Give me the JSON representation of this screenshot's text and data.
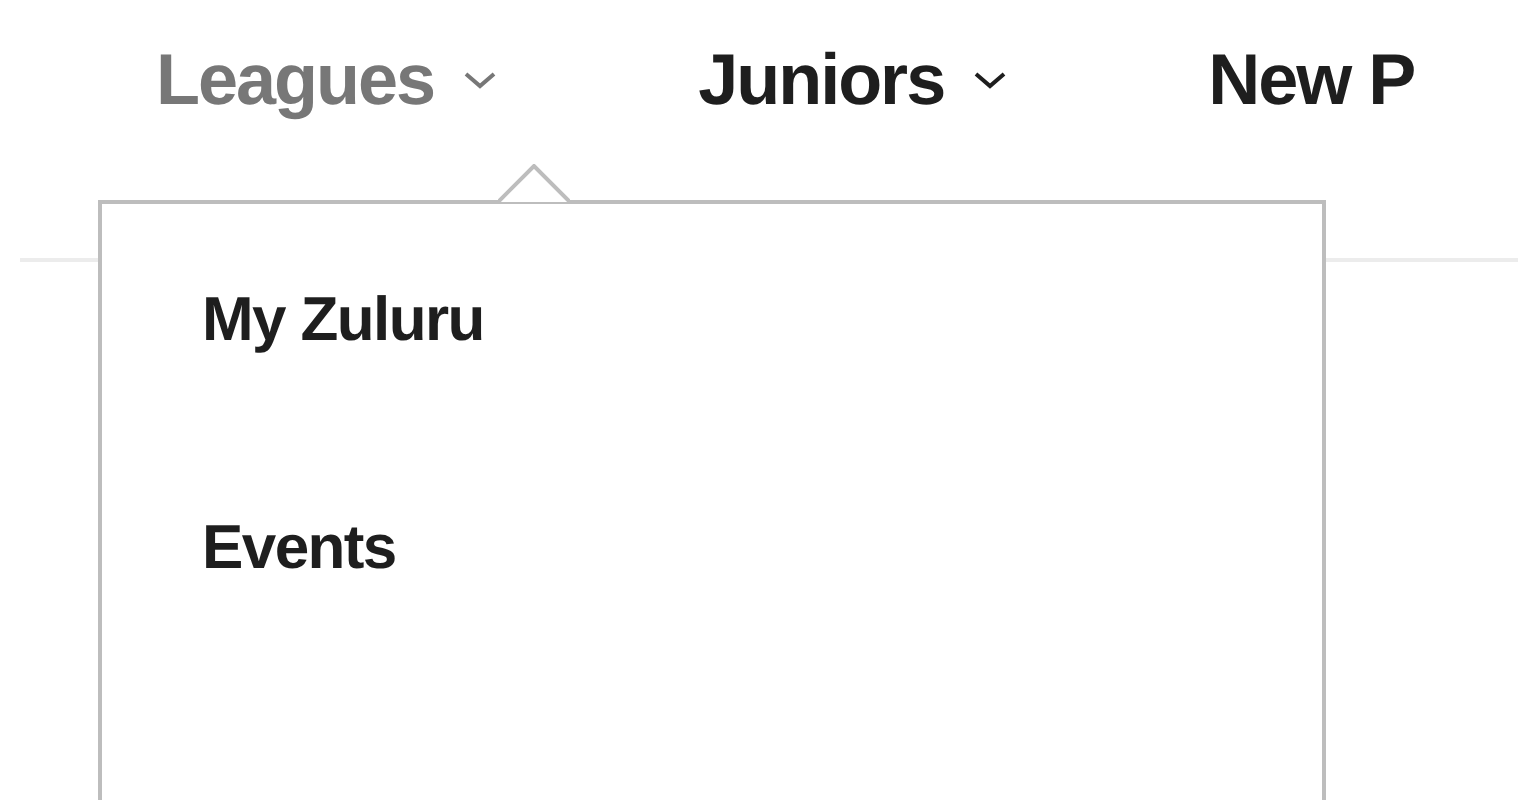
{
  "nav": [
    {
      "label": "Leagues",
      "expanded": true,
      "has_menu": true
    },
    {
      "label": "Juniors",
      "expanded": false,
      "has_menu": true
    },
    {
      "label": "New P",
      "expanded": false,
      "has_menu": false
    }
  ],
  "dropdown": {
    "items": [
      {
        "label": "My Zuluru"
      },
      {
        "label": "Events"
      }
    ]
  }
}
